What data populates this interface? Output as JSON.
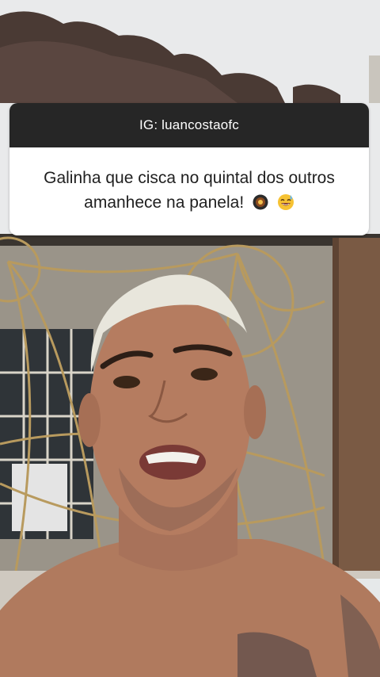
{
  "story": {
    "header": "IG: luancostaofc",
    "question": "Galinha que cisca no quintal dos outros amanhece na panela!",
    "emojis": [
      "cooking-pan-icon",
      "grinning-sweat-icon"
    ]
  },
  "colors": {
    "card_header_bg": "#262626",
    "card_body_bg": "#ffffff",
    "text_dark": "#1f1f1f"
  }
}
